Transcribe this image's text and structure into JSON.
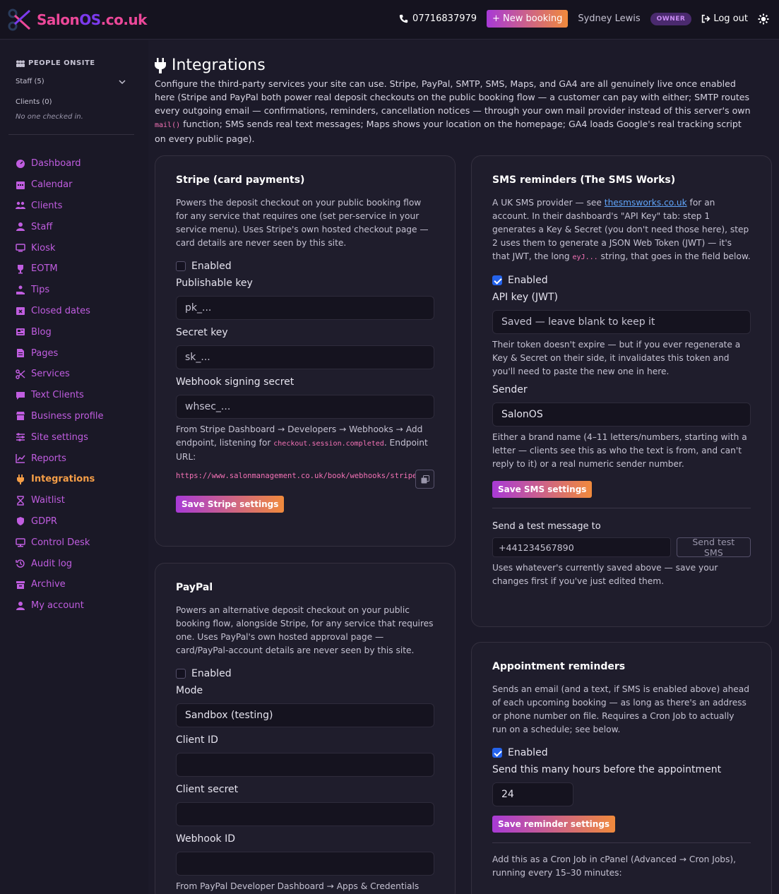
{
  "header": {
    "brand_main": "Salon",
    "brand_os": "OS",
    "brand_suffix": ".co.uk",
    "phone": "07716837979",
    "new_booking": "+ New booking",
    "user_name": "Sydney Lewis",
    "role_badge": "OWNER",
    "logout": "Log out"
  },
  "sidebar": {
    "people_heading": "PEOPLE ONSITE",
    "staff_label": "Staff (5)",
    "clients_label": "Clients (0)",
    "nobody": "No one checked in.",
    "items": [
      {
        "label": "Dashboard",
        "icon": "gauge-icon"
      },
      {
        "label": "Calendar",
        "icon": "calendar-icon"
      },
      {
        "label": "Clients",
        "icon": "users-icon"
      },
      {
        "label": "Staff",
        "icon": "user-icon"
      },
      {
        "label": "Kiosk",
        "icon": "monitor-icon"
      },
      {
        "label": "EOTM",
        "icon": "trophy-icon"
      },
      {
        "label": "Tips",
        "icon": "hand-coin-icon"
      },
      {
        "label": "Closed dates",
        "icon": "calendar-x-icon"
      },
      {
        "label": "Blog",
        "icon": "newspaper-icon"
      },
      {
        "label": "Pages",
        "icon": "file-icon"
      },
      {
        "label": "Services",
        "icon": "scissors-icon"
      },
      {
        "label": "Text Clients",
        "icon": "chat-icon"
      },
      {
        "label": "Business profile",
        "icon": "store-icon"
      },
      {
        "label": "Site settings",
        "icon": "sliders-icon"
      },
      {
        "label": "Reports",
        "icon": "chart-line-icon"
      },
      {
        "label": "Integrations",
        "icon": "plug-icon",
        "active": true
      },
      {
        "label": "Waitlist",
        "icon": "hourglass-icon"
      },
      {
        "label": "GDPR",
        "icon": "shield-icon"
      },
      {
        "label": "Control Desk",
        "icon": "desktop-icon"
      },
      {
        "label": "Audit log",
        "icon": "history-icon"
      },
      {
        "label": "Archive",
        "icon": "archive-icon"
      },
      {
        "label": "My account",
        "icon": "user-icon"
      }
    ]
  },
  "page": {
    "title": "Integrations",
    "intro_1": "Configure the third-party services your site can use. Stripe, PayPal, SMTP, SMS, Maps, and GA4 are all genuinely live once enabled here (Stripe and PayPal both power real deposit checkouts on the public booking flow — a customer can pay with either; SMTP routes every outgoing email — confirmations, reminders, cancellation notices — through your own mail provider instead of this server's own ",
    "intro_code": "mail()",
    "intro_2": " function; SMS sends real text messages; Maps shows your location on the homepage; GA4 loads Google's real tracking script on every public page)."
  },
  "stripe": {
    "title": "Stripe (card payments)",
    "desc": "Powers the deposit checkout on your public booking flow for any service that requires one (set per-service in your service menu). Uses Stripe's own hosted checkout page — card details are never seen by this site.",
    "enabled_label": "Enabled",
    "pk_label": "Publishable key",
    "pk_placeholder": "pk_...",
    "sk_label": "Secret key",
    "sk_placeholder": "sk_...",
    "wh_label": "Webhook signing secret",
    "wh_placeholder": "whsec_...",
    "help_1": "From Stripe Dashboard → Developers → Webhooks → Add endpoint, listening for ",
    "help_code": "checkout.session.completed",
    "help_2": ". Endpoint URL:",
    "url": "https://www.salonmanagement.co.uk/book/webhooks/stripe.php",
    "save": "Save Stripe settings"
  },
  "paypal": {
    "title": "PayPal",
    "desc": "Powers an alternative deposit checkout on your public booking flow, alongside Stripe, for any service that requires one. Uses PayPal's own hosted approval page — card/PayPal-account details are never seen by this site.",
    "enabled_label": "Enabled",
    "mode_label": "Mode",
    "mode_value": "Sandbox (testing)",
    "client_id_label": "Client ID",
    "client_secret_label": "Client secret",
    "webhook_label": "Webhook ID",
    "help": "From PayPal Developer Dashboard → Apps & Credentials"
  },
  "sms": {
    "title": "SMS reminders (The SMS Works)",
    "desc_1": "A UK SMS provider — see ",
    "desc_link": "thesmsworks.co.uk",
    "desc_2": " for an account. In their dashboard's \"API Key\" tab: step 1 generates a Key & Secret (you don't need those here), step 2 uses them to generate a JSON Web Token (JWT) — it's that JWT, the long ",
    "desc_code": "eyJ...",
    "desc_3": " string, that goes in the field below.",
    "enabled_label": "Enabled",
    "api_label": "API key (JWT)",
    "api_placeholder": "Saved — leave blank to keep it",
    "api_help": "Their token doesn't expire — but if you ever regenerate a Key & Secret on their side, it invalidates this token and you'll need to paste the new one in here.",
    "sender_label": "Sender",
    "sender_value": "SalonOS",
    "sender_help": "Either a brand name (4–11 letters/numbers, starting with a letter — clients see this as who the text is from, and can't reply to it) or a real numeric sender number.",
    "save": "Save SMS settings",
    "test_label": "Send a test message to",
    "test_placeholder": "+441234567890",
    "test_button": "Send test SMS",
    "test_help": "Uses whatever's currently saved above — save your changes first if you've just edited them."
  },
  "reminders": {
    "title": "Appointment reminders",
    "desc": "Sends an email (and a text, if SMS is enabled above) ahead of each upcoming booking — as long as there's an address or phone number on file. Requires a Cron Job to actually run on a schedule; see below.",
    "enabled_label": "Enabled",
    "hours_label": "Send this many hours before the appointment",
    "hours_value": "24",
    "save": "Save reminder settings",
    "cron_help": "Add this as a Cron Job in cPanel (Advanced → Cron Jobs), running every 15–30 minutes:"
  }
}
